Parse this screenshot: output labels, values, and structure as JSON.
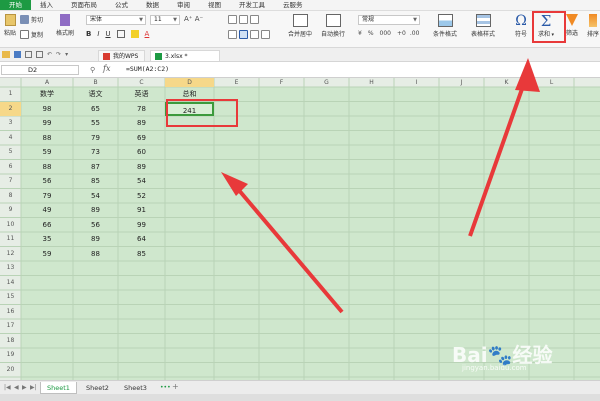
{
  "menu": {
    "tabs": [
      {
        "label": "开始",
        "active": true
      },
      {
        "label": "插入",
        "active": false
      },
      {
        "label": "页面布局",
        "active": false
      },
      {
        "label": "公式",
        "active": false
      },
      {
        "label": "数据",
        "active": false
      },
      {
        "label": "审阅",
        "active": false
      },
      {
        "label": "视图",
        "active": false
      },
      {
        "label": "开发工具",
        "active": false
      },
      {
        "label": "云服务",
        "active": false
      }
    ]
  },
  "ribbon": {
    "paste": "粘贴",
    "cut": "剪切",
    "copy": "复制",
    "format_painter": "格式刷",
    "font_name": "宋体",
    "font_size": "11",
    "merge_center": "合并居中",
    "wrap_text": "自动换行",
    "number_format": "常规",
    "conditional_format": "条件格式",
    "table_style": "表格样式",
    "symbol": "符号",
    "sum": "求和",
    "filter": "筛选",
    "sort": "排序",
    "omega": "Ω",
    "sigma": "Σ"
  },
  "docbar": {
    "tab1": "我的WPS",
    "tab2": "3.xlsx *"
  },
  "formula_bar": {
    "cell_ref": "D2",
    "fx": "fx",
    "formula": "=SUM(A2:C2)"
  },
  "grid": {
    "columns": [
      "A",
      "B",
      "C",
      "D",
      "E",
      "F",
      "G",
      "H",
      "I",
      "J",
      "K",
      "L"
    ],
    "rows": [
      "1",
      "2",
      "3",
      "4",
      "5",
      "6",
      "7",
      "8",
      "9",
      "10",
      "11",
      "12",
      "13",
      "14",
      "15",
      "16",
      "17",
      "18",
      "19",
      "20",
      "21"
    ],
    "headers": [
      "数学",
      "语文",
      "英语",
      "总和"
    ],
    "data": [
      [
        "98",
        "65",
        "78",
        "241"
      ],
      [
        "99",
        "55",
        "89",
        ""
      ],
      [
        "88",
        "79",
        "69",
        ""
      ],
      [
        "59",
        "73",
        "60",
        ""
      ],
      [
        "88",
        "87",
        "89",
        ""
      ],
      [
        "56",
        "85",
        "54",
        ""
      ],
      [
        "79",
        "54",
        "52",
        ""
      ],
      [
        "49",
        "89",
        "91",
        ""
      ],
      [
        "66",
        "56",
        "99",
        ""
      ],
      [
        "35",
        "89",
        "64",
        ""
      ],
      [
        "59",
        "88",
        "85",
        ""
      ]
    ]
  },
  "sheets": {
    "tabs": [
      "Sheet1",
      "Sheet2",
      "Sheet3"
    ],
    "active": "Sheet1",
    "add": "+"
  },
  "watermark": {
    "brand": "Bai",
    "brand2": "经验",
    "url": "jingyan.baidu.com"
  },
  "colors": {
    "accent_green": "#1d9a43",
    "highlight_red": "#e8393a",
    "grid_bg": "#cfe7cd"
  }
}
